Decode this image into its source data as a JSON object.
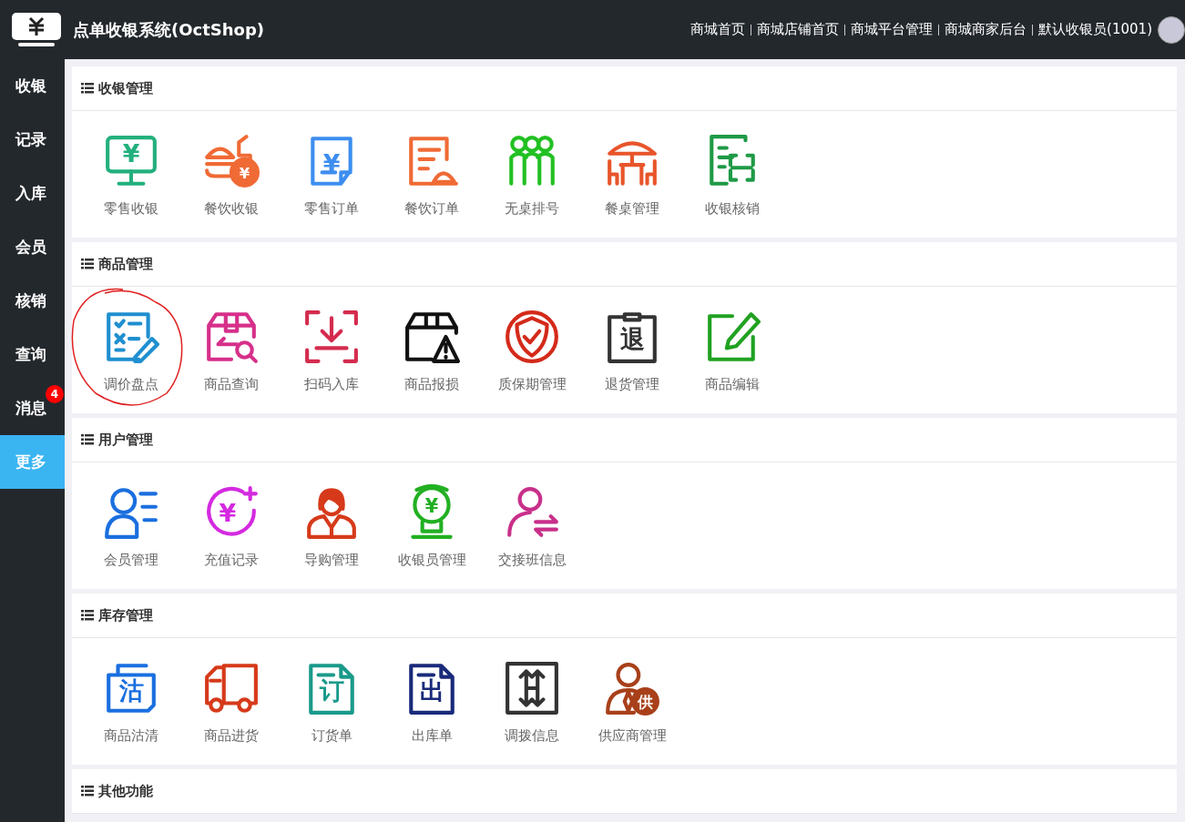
{
  "header": {
    "title": "点单收银系统(OctShop)",
    "links": [
      "商城首页",
      "商城店铺首页",
      "商城平台管理",
      "商城商家后台",
      "默认收银员(1001)"
    ]
  },
  "sidebar": {
    "items": [
      {
        "label": "收银",
        "selected": false
      },
      {
        "label": "记录",
        "selected": false
      },
      {
        "label": "入库",
        "selected": false
      },
      {
        "label": "会员",
        "selected": false
      },
      {
        "label": "核销",
        "selected": false
      },
      {
        "label": "查询",
        "selected": false
      },
      {
        "label": "消息",
        "selected": false,
        "badge": "4"
      },
      {
        "label": "更多",
        "selected": true
      }
    ]
  },
  "sections": [
    {
      "title": "收银管理",
      "items": [
        {
          "label": "零售收银",
          "kind": "monitor",
          "glyph": "¥",
          "color": "#23b07d"
        },
        {
          "label": "餐饮收银",
          "kind": "burger",
          "glyph": "¥",
          "color": "#f06a35"
        },
        {
          "label": "零售订单",
          "kind": "receipt",
          "glyph": "¥",
          "color": "#3d8ef0"
        },
        {
          "label": "餐饮订单",
          "kind": "doc-tray",
          "color": "#f06a35"
        },
        {
          "label": "无桌排号",
          "kind": "people",
          "color": "#22c022"
        },
        {
          "label": "餐桌管理",
          "kind": "table",
          "color": "#e8552a"
        },
        {
          "label": "收银核销",
          "kind": "scan-doc",
          "color": "#1e9a46"
        }
      ]
    },
    {
      "title": "商品管理",
      "items": [
        {
          "label": "调价盘点",
          "kind": "checklist",
          "color": "#1f8fd0",
          "circled": true
        },
        {
          "label": "商品查询",
          "kind": "package",
          "color": "#d6308a"
        },
        {
          "label": "扫码入库",
          "kind": "scan-in",
          "color": "#d42c4e"
        },
        {
          "label": "商品报损",
          "kind": "box-warning",
          "color": "#111111"
        },
        {
          "label": "质保期管理",
          "kind": "shield",
          "color": "#d42a1a"
        },
        {
          "label": "退货管理",
          "kind": "clipboard",
          "glyph": "退",
          "color": "#333333"
        },
        {
          "label": "商品编辑",
          "kind": "edit",
          "color": "#21a121"
        }
      ]
    },
    {
      "title": "用户管理",
      "items": [
        {
          "label": "会员管理",
          "kind": "user-list",
          "color": "#1a6fe0"
        },
        {
          "label": "充值记录",
          "kind": "coin",
          "glyph": "¥",
          "color": "#d42ae0"
        },
        {
          "label": "导购管理",
          "kind": "person",
          "color": "#d63a1a"
        },
        {
          "label": "收银员管理",
          "kind": "cashier",
          "glyph": "¥",
          "color": "#22b022"
        },
        {
          "label": "交接班信息",
          "kind": "exchange",
          "color": "#c8308a"
        }
      ]
    },
    {
      "title": "库存管理",
      "items": [
        {
          "label": "商品沽清",
          "kind": "copy",
          "glyph": "沽",
          "color": "#1a6fe0"
        },
        {
          "label": "商品进货",
          "kind": "truck",
          "color": "#d63a1a"
        },
        {
          "label": "订货单",
          "kind": "file",
          "glyph": "订",
          "color": "#1a9a8a"
        },
        {
          "label": "出库单",
          "kind": "file",
          "glyph": "出",
          "color": "#1a2a7a"
        },
        {
          "label": "调拨信息",
          "kind": "transfer",
          "color": "#333333"
        },
        {
          "label": "供应商管理",
          "kind": "supplier",
          "glyph": "供",
          "color": "#a8401a"
        }
      ]
    },
    {
      "title": "其他功能"
    }
  ]
}
